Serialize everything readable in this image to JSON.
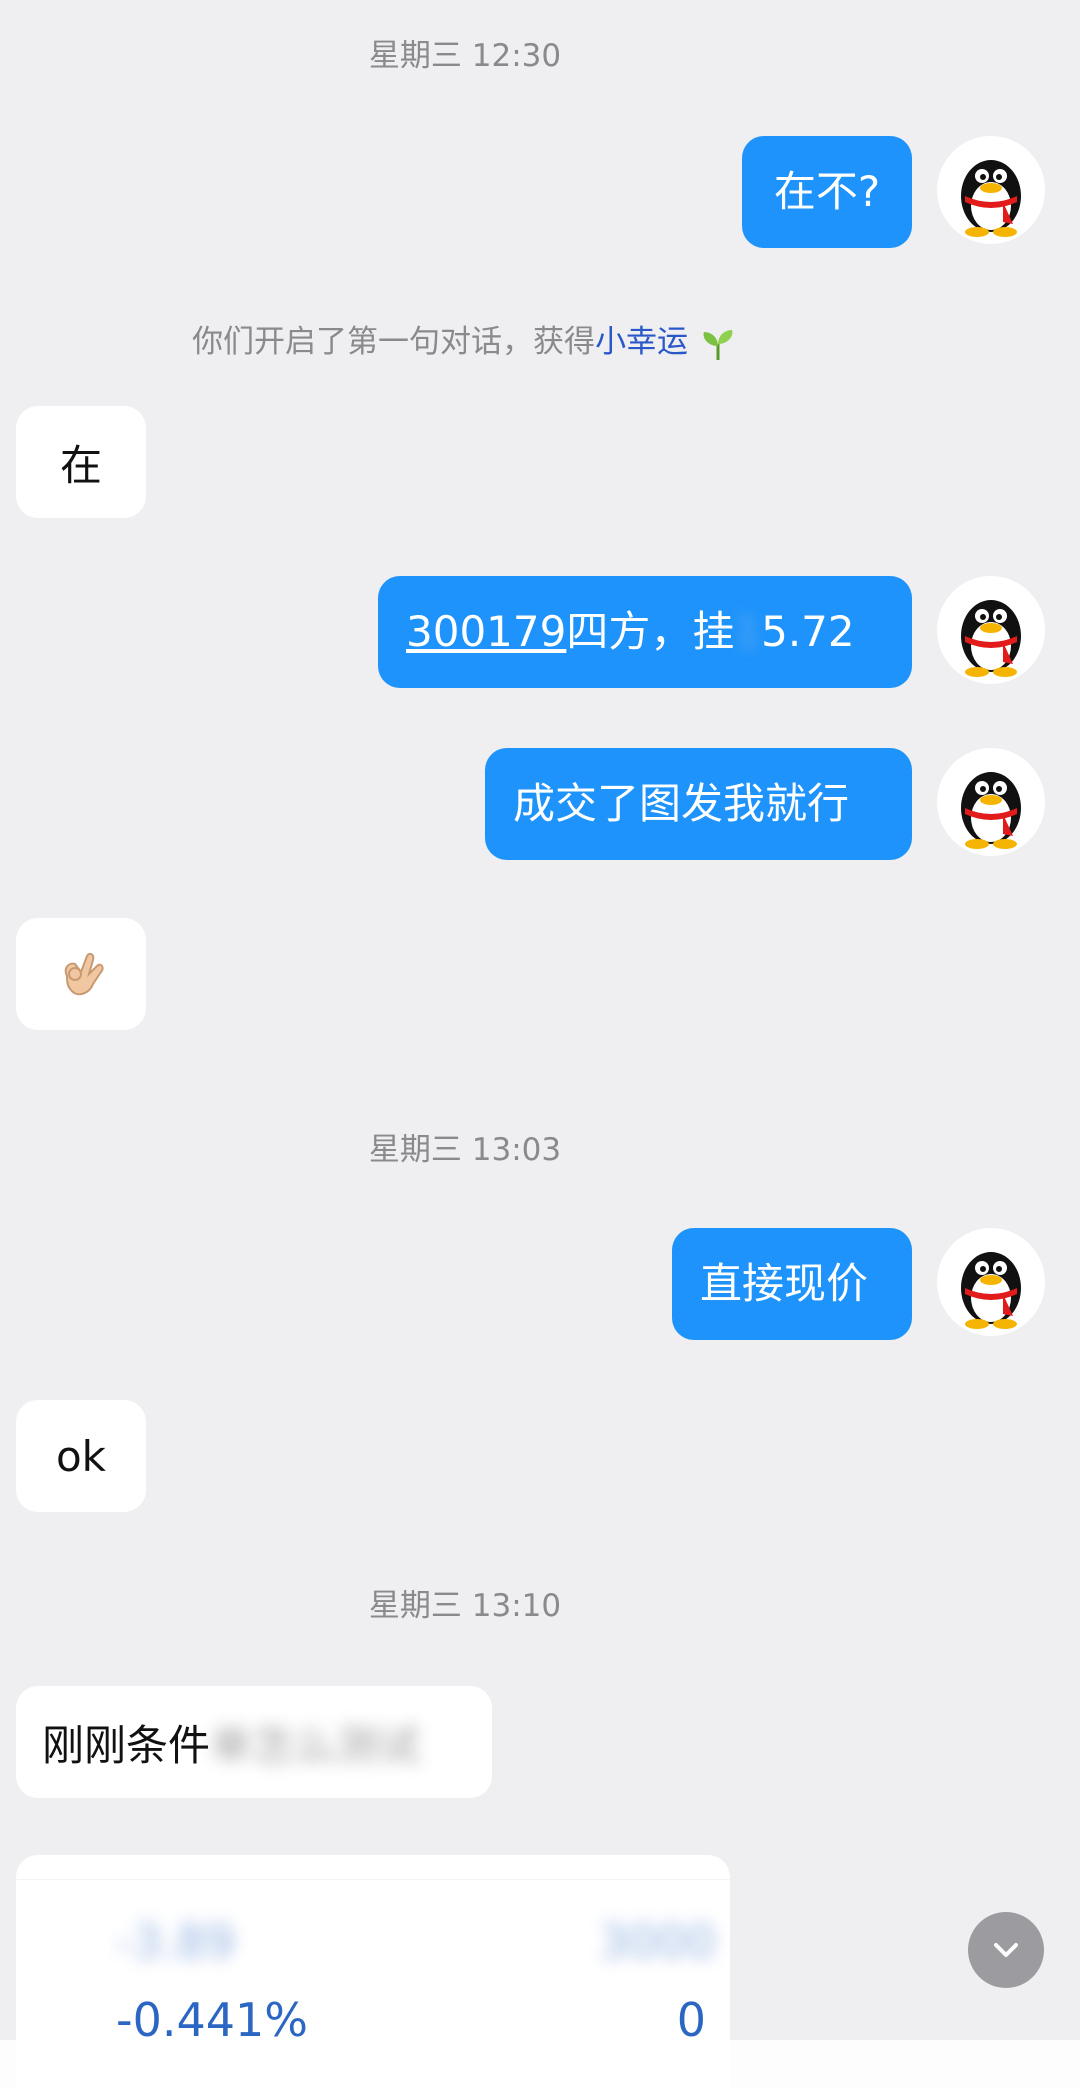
{
  "messages": {
    "ts1": "星期三 12:30",
    "m1": "在不?",
    "notice_prefix": "你们开启了第一句对话，获得",
    "notice_link": "小幸运",
    "m2": "在",
    "m3_code": "300179",
    "m3_text": "四方，挂",
    "m3_blur": "1",
    "m3_tail": "5.72",
    "m4": "成交了图发我就行",
    "ts2": "星期三 13:03",
    "m6_text": "直接现价",
    "m7": "ok",
    "ts3": "星期三 13:10",
    "m8_text": "刚刚条件",
    "m8_blur": "单怎么测试"
  },
  "card": {
    "value_blur_left": "-3.89",
    "value_blur_right": "3000",
    "percent": "-0.441%",
    "right_value": "0"
  },
  "icons": {
    "avatar": "qq-penguin-icon",
    "sprout": "sprout-icon",
    "ok_hand": "ok-hand-emoji-icon",
    "scroll": "chevron-down-icon"
  },
  "colors": {
    "bubble_out": "#1d93fb",
    "bubble_in": "#ffffff",
    "background": "#efeff1",
    "link": "#2b58c9"
  }
}
